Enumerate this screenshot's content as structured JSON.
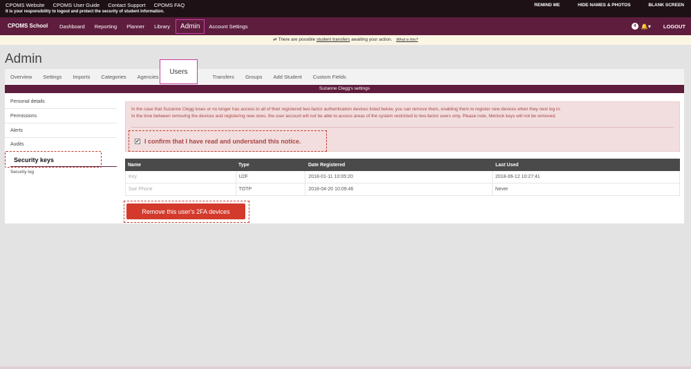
{
  "topbar": {
    "links": [
      "CPOMS Website",
      "CPOMS User Guide",
      "Contact Support",
      "CPOMS FAQ"
    ],
    "note": "It is your responsibility to logout and protect the security of student information.",
    "right": [
      "REMIND ME",
      "HIDE NAMES & PHOTOS",
      "BLANK SCREEN"
    ]
  },
  "nav": {
    "brand": "CPOMS School",
    "items": [
      "Dashboard",
      "Reporting",
      "Planner",
      "Library",
      "Admin",
      "Account Settings"
    ],
    "active": "Admin",
    "badge": "4",
    "logout": "LOGOUT"
  },
  "notice": {
    "prefix": "There are possible",
    "link": "student transfers",
    "suffix": "awaiting your action.",
    "help": "What is this?"
  },
  "page": {
    "title": "Admin"
  },
  "tabs": [
    "Overview",
    "Settings",
    "Imports",
    "Categories",
    "Agencies",
    "Users",
    "Transfers",
    "Groups",
    "Add Student",
    "Custom Fields"
  ],
  "header": "Suzanne Clegg's settings",
  "sidebar": [
    "Personal details",
    "Permissions",
    "Alerts",
    "Audits",
    "Security keys",
    "Security log"
  ],
  "alert": {
    "line1": "In the case that Suzanne Clegg loses or no longer has access to all of their registered two-factor authentication devices listed below, you can remove them, enabling them to register new devices when they next log in.",
    "line2": "In the time between removing the devices and registering new ones, the user account will not be able to access areas of the system restricted to two-factor users only. Please note, Merlock keys will not be removed.",
    "confirm": "I confirm that I have read and understand this notice."
  },
  "table": {
    "headers": [
      "Name",
      "Type",
      "Date Registered",
      "Last Used"
    ],
    "rows": [
      [
        "Key",
        "U2F",
        "2018-01-11 10:05:20",
        "2018-06-12 10:27:41"
      ],
      [
        "Sue Phone",
        "TOTP",
        "2018-04-20 10:09:46",
        "Never"
      ]
    ]
  },
  "button": {
    "label": "Remove this user's 2FA devices"
  },
  "colors": {
    "brand": "#5e1d3c",
    "danger": "#d33a2c",
    "alert_bg": "#f2dede"
  }
}
